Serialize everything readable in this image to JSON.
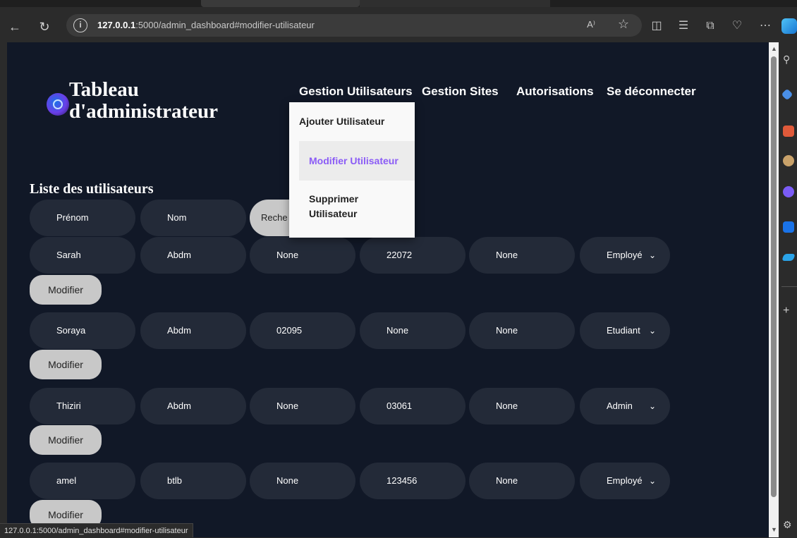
{
  "browser": {
    "url_host": "127.0.0.1",
    "url_rest": ":5000/admin_dashboard#modifier-utilisateur",
    "read_aloud": "A⁾",
    "status_url": "127.0.0.1:5000/admin_dashboard#modifier-utilisateur"
  },
  "header": {
    "title_line1": "Tableau",
    "title_line2": "d'administrateur"
  },
  "nav": {
    "users": "Gestion Utilisateurs",
    "sites": "Gestion Sites",
    "permissions": "Autorisations",
    "logout": "Se déconnecter"
  },
  "dropdown": {
    "add": "Ajouter Utilisateur",
    "edit": "Modifier Utilisateur",
    "delete_line1": "Supprimer",
    "delete_line2": "Utilisateur"
  },
  "list": {
    "title": "Liste des utilisateurs",
    "search_placeholder_visible": "Reche",
    "header": [
      "Prénom",
      "Nom"
    ],
    "rows": [
      {
        "prenom": "Sarah",
        "nom": "Abdm",
        "c3": "None",
        "c4": "22072",
        "c5": "None",
        "role": "Employé"
      },
      {
        "prenom": "Soraya",
        "nom": "Abdm",
        "c3": "02095",
        "c4": "None",
        "c5": "None",
        "role": "Etudiant"
      },
      {
        "prenom": "Thiziri",
        "nom": "Abdm",
        "c3": "None",
        "c4": "03061",
        "c5": "None",
        "role": "Admin"
      },
      {
        "prenom": "amel",
        "nom": "btlb",
        "c3": "None",
        "c4": "123456",
        "c5": "None",
        "role": "Employé"
      }
    ],
    "modify_label": "Modifier"
  }
}
